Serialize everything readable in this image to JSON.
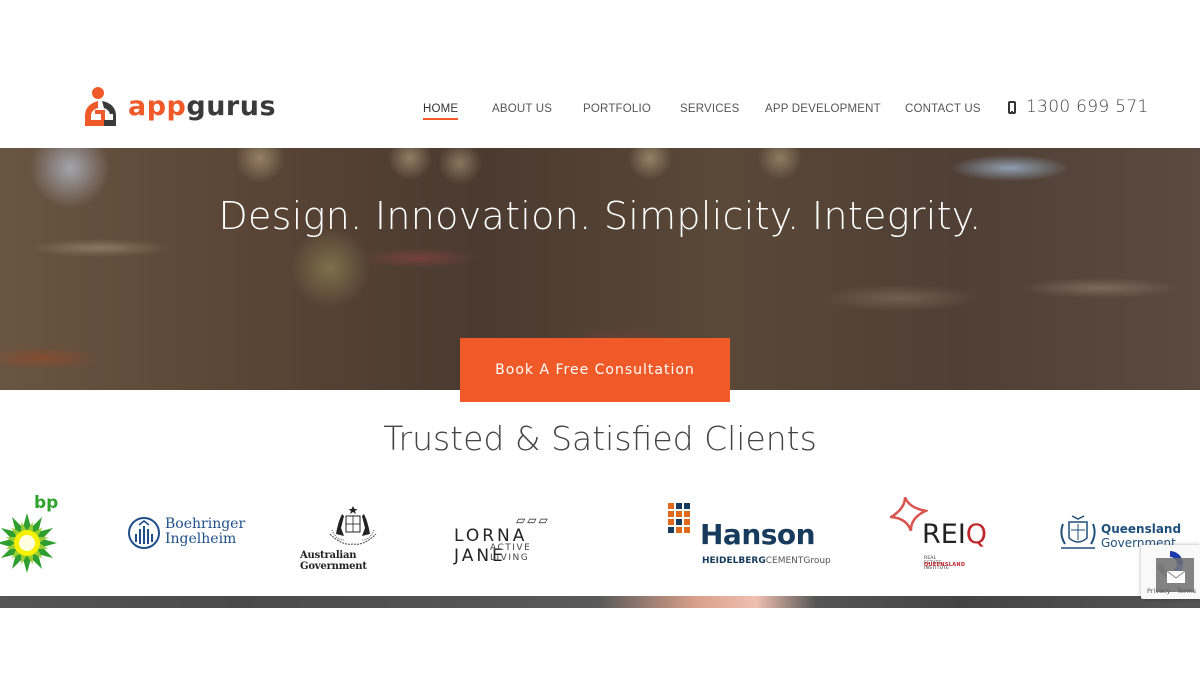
{
  "header": {
    "logo": {
      "part1": "app",
      "part2": "gurus",
      "brand_color": "#f05a28"
    },
    "nav": [
      {
        "label": "HOME",
        "active": true
      },
      {
        "label": "ABOUT US",
        "active": false
      },
      {
        "label": "PORTFOLIO",
        "active": false
      },
      {
        "label": "SERVICES",
        "active": false
      },
      {
        "label": "APP DEVELOPMENT",
        "active": false
      },
      {
        "label": "CONTACT US",
        "active": false
      }
    ],
    "phone": {
      "icon": "mobile-phone-icon",
      "number": "1300 699 571"
    }
  },
  "hero": {
    "title": "Design. Innovation. Simplicity. Integrity.",
    "cta_label": "Book A Free Consultation",
    "cta_color": "#f05a28"
  },
  "clients": {
    "title": "Trusted & Satisfied Clients",
    "logos": [
      {
        "name": "bp",
        "text": "bp"
      },
      {
        "name": "Boehringer Ingelheim",
        "line1": "Boehringer",
        "line2": "Ingelheim"
      },
      {
        "name": "Australian Government",
        "text": "Australian Government"
      },
      {
        "name": "Lorna Jane",
        "boxes": "▱▱▱",
        "line1": "LORNA JANE",
        "line2": "ACTIVE LIVING"
      },
      {
        "name": "Hanson",
        "line1": "Hanson",
        "sub_bold": "HEIDELBERG",
        "sub_plain": "CEMENTGroup"
      },
      {
        "name": "REIQ",
        "line1a": "REI",
        "line1b": "Q",
        "sub1": "REAL ESTATE INSTITUTE",
        "sub2": "QUEENSLAND"
      },
      {
        "name": "Queensland Government",
        "line1": "Queensland",
        "line2": "Government"
      }
    ]
  },
  "recaptcha": {
    "links": "Privacy - Terms"
  }
}
